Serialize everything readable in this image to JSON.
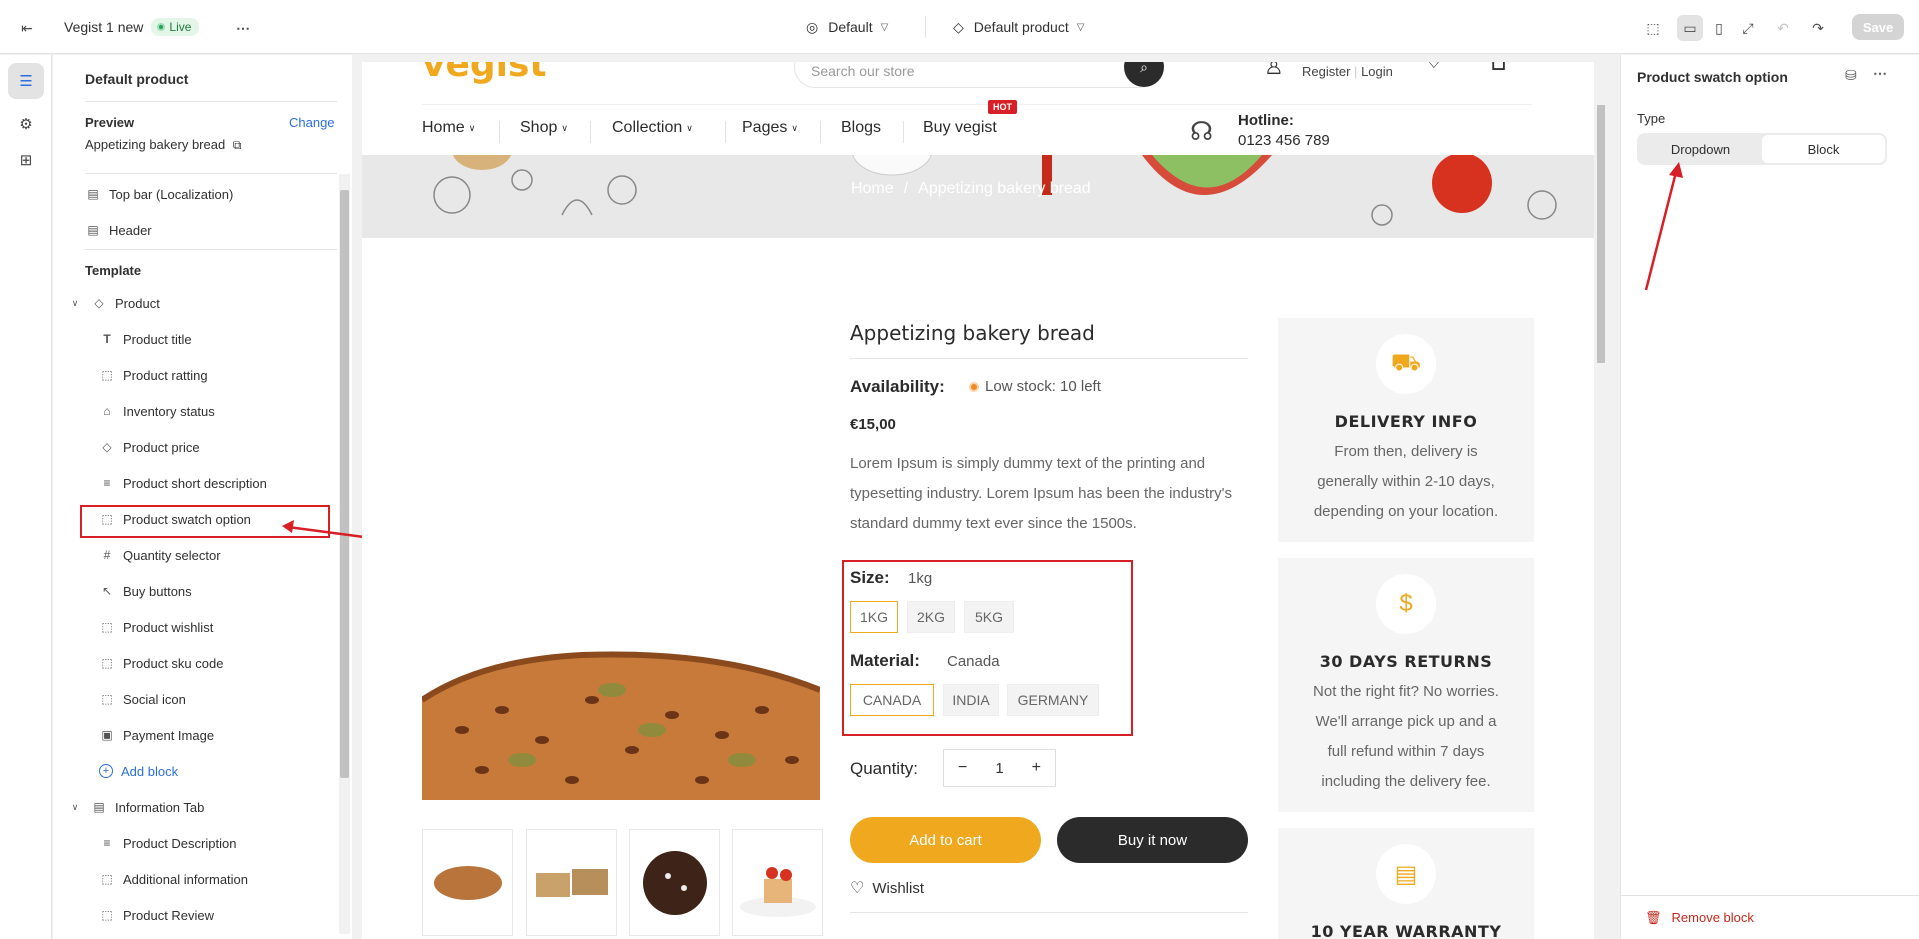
{
  "topbar": {
    "store_name": "Vegist 1 new",
    "status": "Live",
    "theme_select": "Default",
    "template_select": "Default product",
    "save_label": "Save"
  },
  "sidebar": {
    "title": "Default product",
    "preview_label": "Preview",
    "preview_change": "Change",
    "preview_value": "Appetizing bakery bread",
    "sections": [
      "Top bar (Localization)",
      "Header"
    ],
    "template_label": "Template",
    "product_group": "Product",
    "product_blocks": [
      "Product title",
      "Product ratting",
      "Inventory status",
      "Product price",
      "Product short description",
      "Product swatch option",
      "Quantity selector",
      "Buy buttons",
      "Product wishlist",
      "Product sku code",
      "Social icon",
      "Payment Image"
    ],
    "add_block": "Add block",
    "info_group": "Information Tab",
    "info_blocks": [
      "Product Description",
      "Additional information",
      "Product Review"
    ]
  },
  "store": {
    "logo": "vegist",
    "search_placeholder": "Search our store",
    "register": "Register",
    "login": "Login",
    "nav": [
      "Home",
      "Shop",
      "Collection",
      "Pages",
      "Blogs",
      "Buy vegist"
    ],
    "hot": "HOT",
    "hotline_label": "Hotline:",
    "hotline_number": "0123 456 789",
    "breadcrumb_home": "Home",
    "breadcrumb_sep": "/",
    "breadcrumb_current": "Appetizing bakery bread"
  },
  "product": {
    "title": "Appetizing bakery bread",
    "availability_label": "Availability:",
    "availability_value": "Low stock: 10 left",
    "price": "€15,00",
    "description": "Lorem Ipsum is simply dummy text of the printing and typesetting industry. Lorem Ipsum has been the industry's standard dummy text ever since the 1500s.",
    "size_label": "Size:",
    "size_value": "1kg",
    "sizes": [
      "1KG",
      "2KG",
      "5KG"
    ],
    "material_label": "Material:",
    "material_value": "Canada",
    "materials": [
      "CANADA",
      "INDIA",
      "GERMANY"
    ],
    "quantity_label": "Quantity:",
    "quantity_minus": "−",
    "quantity_value": "1",
    "quantity_plus": "+",
    "add_to_cart": "Add to cart",
    "buy_now": "Buy it now",
    "wishlist": "Wishlist"
  },
  "info": [
    {
      "title": "DELIVERY INFO",
      "text": "From then, delivery is generally within 2-10 days, depending on your location."
    },
    {
      "title": "30 DAYS RETURNS",
      "text": "Not the right fit? No worries. We'll arrange pick up and a full refund within 7 days including the delivery fee."
    },
    {
      "title": "10 YEAR WARRANTY",
      "text": ""
    }
  ],
  "right_panel": {
    "title": "Product swatch option",
    "type_label": "Type",
    "options": [
      "Dropdown",
      "Block"
    ],
    "selected": "Block",
    "remove": "Remove block"
  },
  "colors": {
    "accent": "#f0a91f",
    "annotation": "#d81f26",
    "link": "#2a6fdb"
  }
}
